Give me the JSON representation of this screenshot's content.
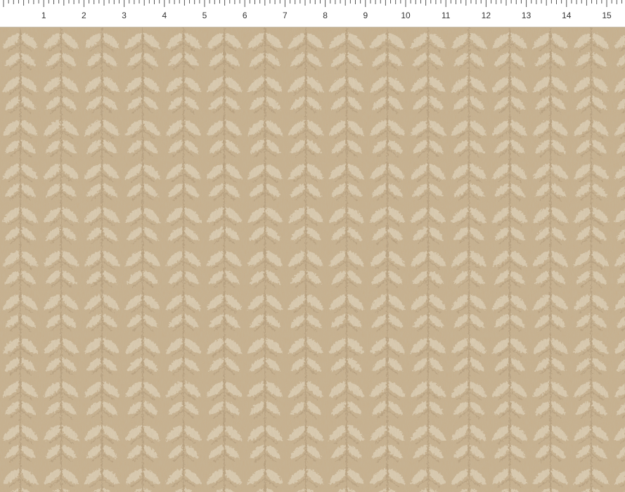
{
  "ruler": {
    "labels": [
      "1",
      "2",
      "3",
      "4",
      "5",
      "6",
      "7",
      "8",
      "9",
      "10",
      "11",
      "12",
      "13",
      "14",
      "15"
    ],
    "minor_ticks_per_unit": 8
  },
  "fabric": {
    "motif": "leaf-and-stem pattern",
    "colors": {
      "base": "#c7b08d",
      "motif": "#dccdb2",
      "stem": "#b69e7c",
      "highlight": "#e6dac4"
    }
  }
}
